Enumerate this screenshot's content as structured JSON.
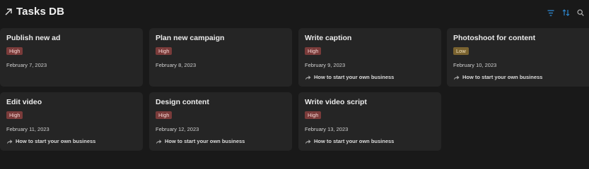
{
  "header": {
    "title": "Tasks DB",
    "title_icon": "arrow-up-right-icon",
    "toolbar": {
      "filter_icon": "filter-icon",
      "sort_icon": "sort-icon",
      "search_icon": "search-icon"
    }
  },
  "colors": {
    "background": "#191919",
    "card": "#252525",
    "accent": "#2e8bd6",
    "high_badge": "#7a3b3a",
    "low_badge": "#7a6330"
  },
  "cards": [
    {
      "title": "Publish new ad",
      "priority": "High",
      "date": "February 7, 2023",
      "relation": ""
    },
    {
      "title": "Plan new campaign",
      "priority": "High",
      "date": "February 8, 2023",
      "relation": ""
    },
    {
      "title": "Write caption",
      "priority": "High",
      "date": "February 9, 2023",
      "relation": "How to start your own business"
    },
    {
      "title": "Photoshoot for content",
      "priority": "Low",
      "date": "February 10, 2023",
      "relation": "How to start your own business"
    },
    {
      "title": "Edit video",
      "priority": "High",
      "date": "February 11, 2023",
      "relation": "How to start your own business"
    },
    {
      "title": "Design content",
      "priority": "High",
      "date": "February 12, 2023",
      "relation": "How to start your own business"
    },
    {
      "title": "Write video script",
      "priority": "High",
      "date": "February 13, 2023",
      "relation": "How to start your own business"
    }
  ]
}
